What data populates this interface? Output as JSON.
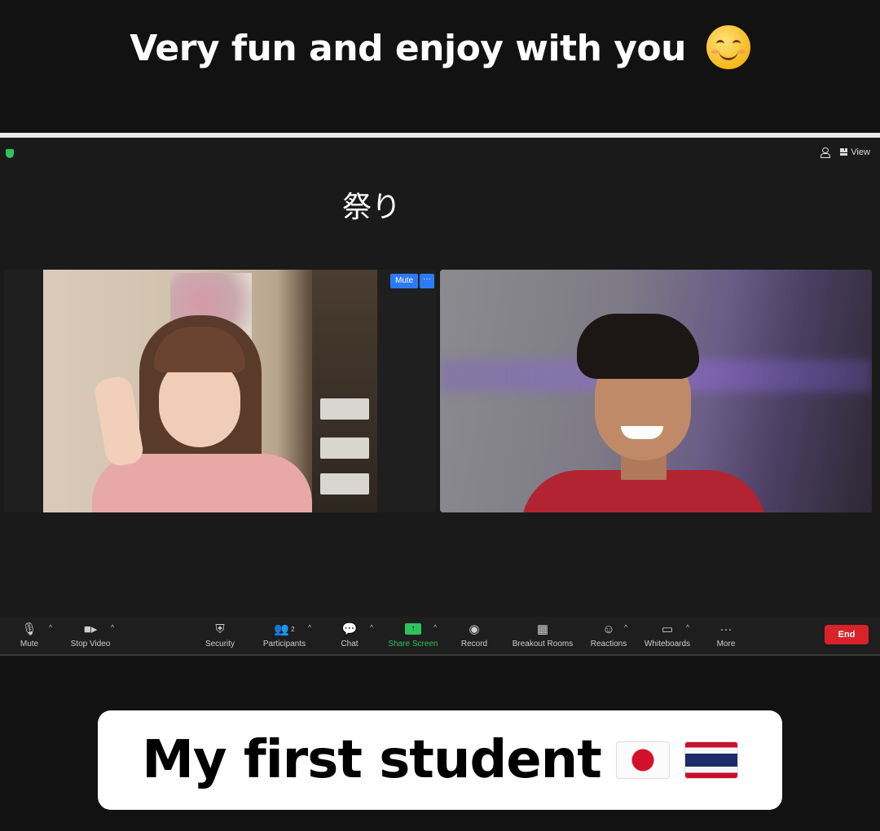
{
  "top_caption": {
    "text": "Very fun and enjoy with you",
    "emoji": "smiling-face-emoji"
  },
  "meeting": {
    "header": {
      "view_label": "View"
    },
    "overlay_text": "祭り",
    "participants": [
      {
        "position": "left",
        "hover_buttons": {
          "mute_label": "Mute",
          "more_label": "···"
        }
      },
      {
        "position": "right"
      }
    ],
    "toolbar": {
      "items": [
        {
          "name": "mute",
          "label": "Mute",
          "icon": "microphone-icon",
          "has_caret": true
        },
        {
          "name": "stop-video",
          "label": "Stop Video",
          "icon": "video-camera-icon",
          "has_caret": true
        },
        {
          "name": "security",
          "label": "Security",
          "icon": "shield-icon",
          "has_caret": false
        },
        {
          "name": "participants",
          "label": "Participants",
          "icon": "people-icon",
          "count": "2",
          "has_caret": true
        },
        {
          "name": "chat",
          "label": "Chat",
          "icon": "chat-bubble-icon",
          "has_caret": true
        },
        {
          "name": "share-screen",
          "label": "Share Screen",
          "icon": "share-screen-icon",
          "has_caret": true,
          "accent": "#2ec25c"
        },
        {
          "name": "record",
          "label": "Record",
          "icon": "record-icon",
          "has_caret": false
        },
        {
          "name": "breakout-rooms",
          "label": "Breakout Rooms",
          "icon": "grid-icon",
          "has_caret": false
        },
        {
          "name": "reactions",
          "label": "Reactions",
          "icon": "emoji-add-icon",
          "has_caret": true
        },
        {
          "name": "whiteboards",
          "label": "Whiteboards",
          "icon": "whiteboard-icon",
          "has_caret": true
        },
        {
          "name": "more",
          "label": "More",
          "icon": "ellipsis-icon",
          "has_caret": false
        }
      ],
      "end_label": "End",
      "end_color": "#d8232a"
    }
  },
  "bottom_caption": {
    "text": "My first student",
    "flags": [
      "japan-flag",
      "thailand-flag"
    ]
  }
}
